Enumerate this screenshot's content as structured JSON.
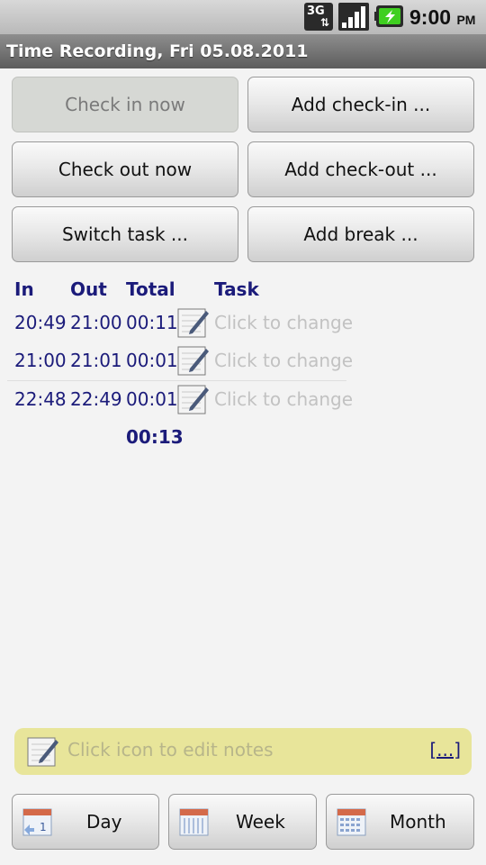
{
  "status_bar": {
    "network": "3G",
    "time": "9:00",
    "ampm": "PM"
  },
  "title": "Time Recording, Fri 05.08.2011",
  "buttons": {
    "check_in_now": "Check in now",
    "add_check_in": "Add check-in ...",
    "check_out_now": "Check out now",
    "add_check_out": "Add check-out ...",
    "switch_task": "Switch task ...",
    "add_break": "Add break ..."
  },
  "table": {
    "headers": {
      "in": "In",
      "out": "Out",
      "total": "Total",
      "task": "Task"
    },
    "rows": [
      {
        "in": "20:49",
        "out": "21:00",
        "total": "00:11",
        "task": "Click to change"
      },
      {
        "in": "21:00",
        "out": "21:01",
        "total": "00:01",
        "task": "Click to change"
      },
      {
        "in": "22:48",
        "out": "22:49",
        "total": "00:01",
        "task": "Click to change"
      }
    ],
    "sum_total": "00:13"
  },
  "notes": {
    "placeholder": "Click icon to edit notes",
    "more": "[...]"
  },
  "nav": {
    "day": "Day",
    "week": "Week",
    "month": "Month"
  },
  "colors": {
    "accent_text": "#1b1b7a",
    "notes_bg": "#e8e59a",
    "title_bg": "#6f6f6f"
  }
}
